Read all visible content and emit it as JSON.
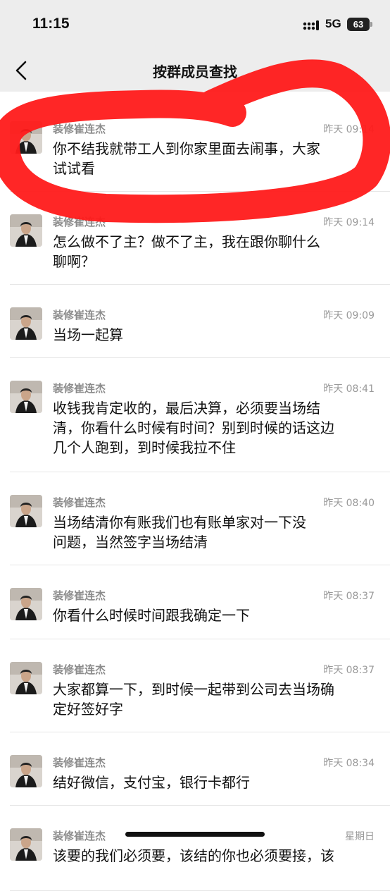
{
  "status_bar": {
    "time": "11:15",
    "network": "5G",
    "battery": "63"
  },
  "header": {
    "title": "按群成员查找",
    "back_icon": "chevron-left-icon"
  },
  "messages": [
    {
      "sender": "装修崔连杰",
      "time": "昨天 09:14",
      "text_lines": [
        "你不结我就带工人到你家里面去闹事，大家",
        "试试看"
      ]
    },
    {
      "sender": "装修崔连杰",
      "time": "昨天 09:14",
      "text_lines": [
        "怎么做不了主？做不了主，我在跟你聊什么",
        "聊啊？"
      ]
    },
    {
      "sender": "装修崔连杰",
      "time": "昨天 09:09",
      "text_lines": [
        "当场一起算"
      ]
    },
    {
      "sender": "装修崔连杰",
      "time": "昨天 08:41",
      "text_lines": [
        "收钱我肯定收的，最后决算，必须要当场结",
        "清，你看什么时候有时间？别到时候的话这边",
        "几个人跑到，到时候我拉不住"
      ]
    },
    {
      "sender": "装修崔连杰",
      "time": "昨天 08:40",
      "text_lines": [
        "当场结清你有账我们也有账单家对一下没",
        "问题，当然签字当场结清"
      ]
    },
    {
      "sender": "装修崔连杰",
      "time": "昨天 08:37",
      "text_lines": [
        "你看什么时候时间跟我确定一下"
      ]
    },
    {
      "sender": "装修崔连杰",
      "time": "昨天 08:37",
      "text_lines": [
        "大家都算一下，到时候一起带到公司去当场确",
        "定好签好字"
      ]
    },
    {
      "sender": "装修崔连杰",
      "time": "昨天 08:34",
      "text_lines": [
        "结好微信，支付宝，银行卡都行"
      ]
    },
    {
      "sender": "装修崔连杰",
      "time": "星期日",
      "text_lines": [
        "该要的我们必须要，该结的你也必须要接，该"
      ]
    }
  ],
  "annotation": {
    "color": "#ff1a1a",
    "shape": "hand-drawn circle around first message"
  }
}
